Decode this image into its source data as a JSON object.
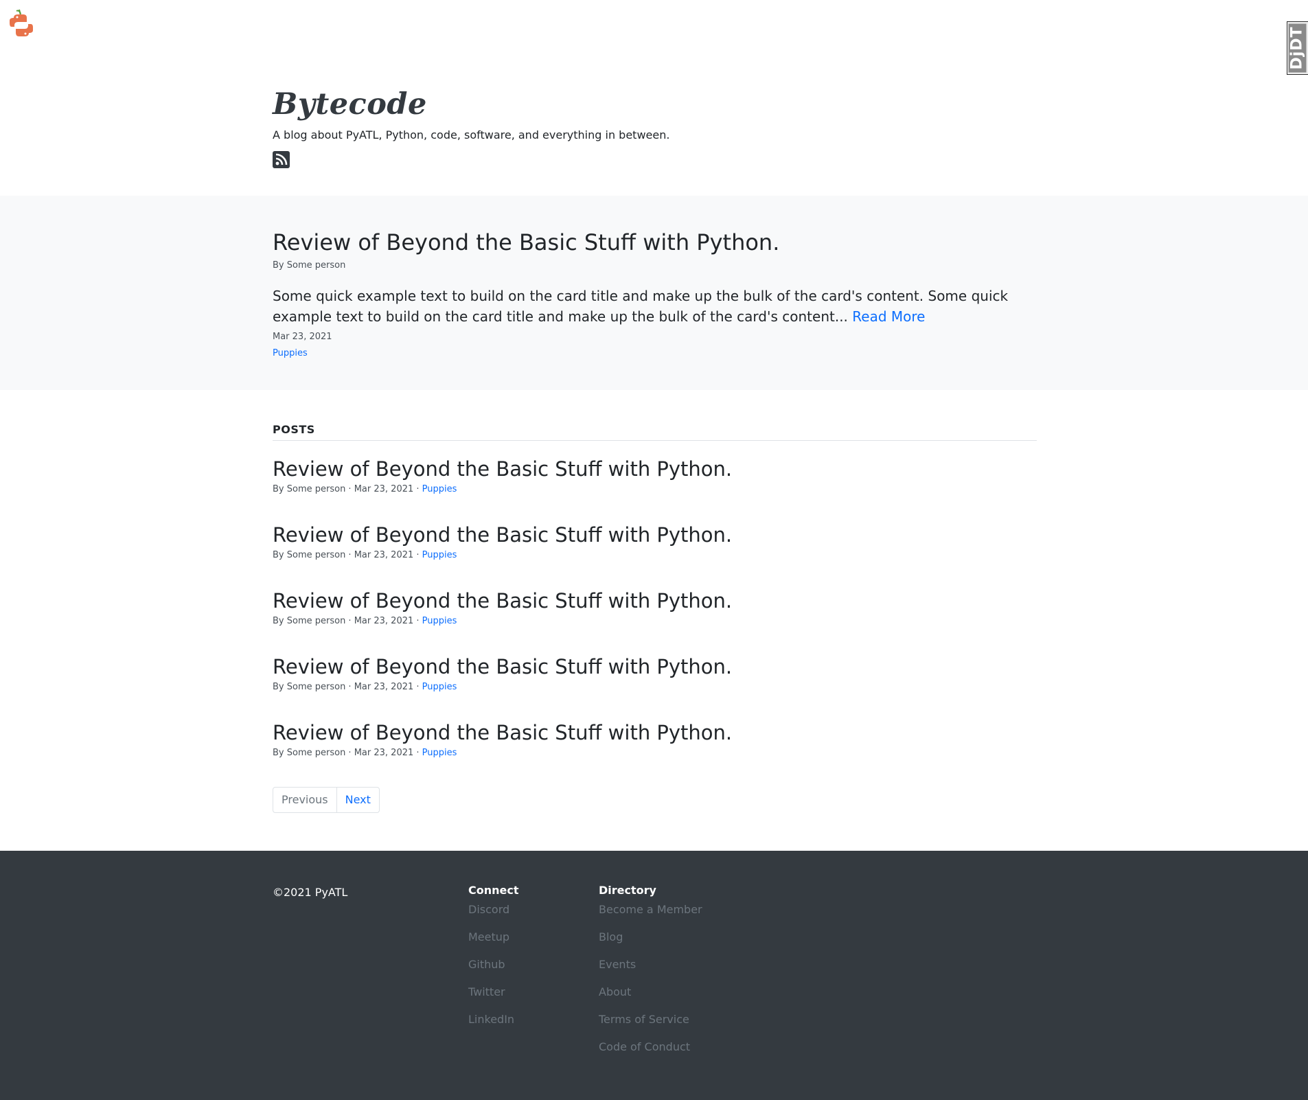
{
  "djdt": {
    "label": "DjDT"
  },
  "header": {
    "title": "Bytecode",
    "tagline": "A blog about PyATL, Python, code, software, and everything in between."
  },
  "featured": {
    "title": "Review of Beyond the Basic Stuff with Python.",
    "author": "By Some person",
    "excerpt": "Some quick example text to build on the card title and make up the bulk of the card's content. Some quick example text to build on the card title and make up the bulk of the card's content...",
    "read_more": "Read More",
    "date": "Mar 23, 2021",
    "tag": "Puppies"
  },
  "posts": {
    "heading": "POSTS",
    "items": [
      {
        "title": "Review of Beyond the Basic Stuff with Python.",
        "meta": "By Some person · Mar 23, 2021 · ",
        "tag": "Puppies"
      },
      {
        "title": "Review of Beyond the Basic Stuff with Python.",
        "meta": "By Some person · Mar 23, 2021 · ",
        "tag": "Puppies"
      },
      {
        "title": "Review of Beyond the Basic Stuff with Python.",
        "meta": "By Some person · Mar 23, 2021 · ",
        "tag": "Puppies"
      },
      {
        "title": "Review of Beyond the Basic Stuff with Python.",
        "meta": "By Some person · Mar 23, 2021 · ",
        "tag": "Puppies"
      },
      {
        "title": "Review of Beyond the Basic Stuff with Python.",
        "meta": "By Some person · Mar 23, 2021 · ",
        "tag": "Puppies"
      }
    ],
    "pagination": {
      "previous": "Previous",
      "next": "Next"
    }
  },
  "footer": {
    "copyright": "©2021 PyATL",
    "connect": {
      "heading": "Connect",
      "links": [
        "Discord",
        "Meetup",
        "Github",
        "Twitter",
        "LinkedIn"
      ]
    },
    "directory": {
      "heading": "Directory",
      "links": [
        "Become a Member",
        "Blog",
        "Events",
        "About",
        "Terms of Service",
        "Code of Conduct"
      ]
    }
  },
  "colors": {
    "accent": "#0d6efd",
    "footer_bg": "#343a40",
    "featured_bg": "#f8f9fa"
  }
}
